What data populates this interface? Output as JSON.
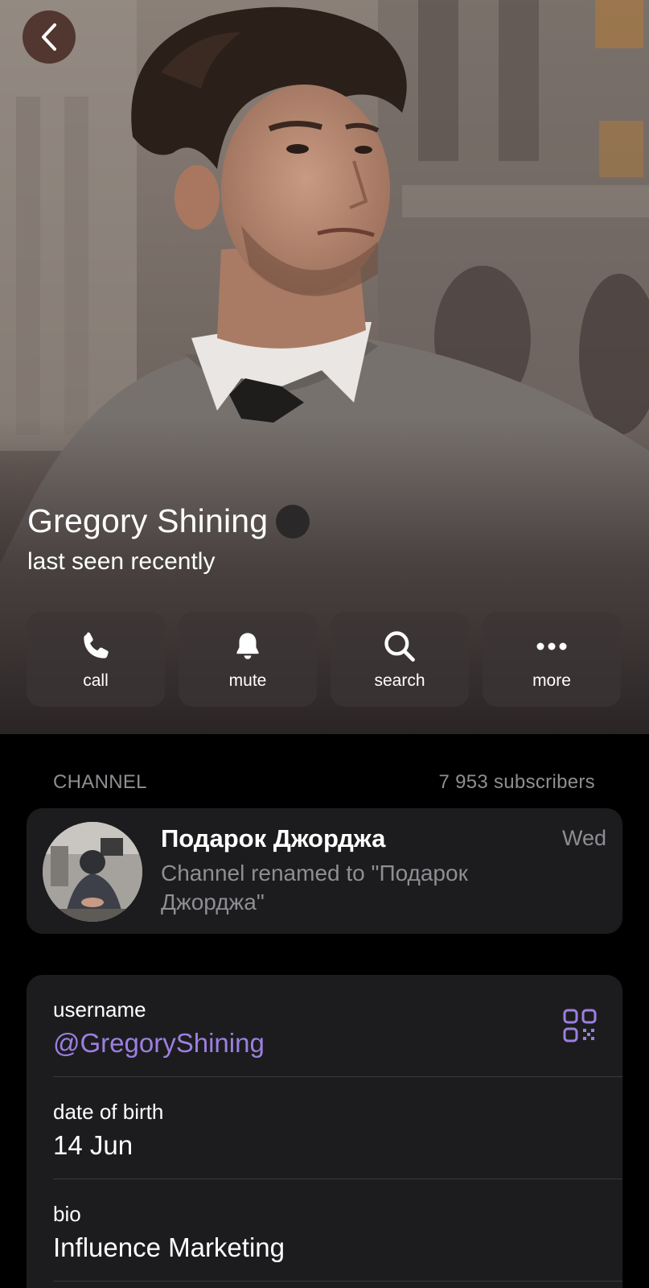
{
  "profile": {
    "name": "Gregory Shining",
    "status": "last seen recently"
  },
  "actions": [
    {
      "label": "call",
      "icon": "phone-icon"
    },
    {
      "label": "mute",
      "icon": "bell-icon"
    },
    {
      "label": "search",
      "icon": "search-icon"
    },
    {
      "label": "more",
      "icon": "more-dots-icon"
    }
  ],
  "channel_section": {
    "header": "CHANNEL",
    "subscribers": "7 953 subscribers",
    "channel": {
      "title": "Подарок Джорджа",
      "time": "Wed",
      "preview": "Channel renamed to \"Подарок Джорджа\""
    }
  },
  "info": {
    "username_label": "username",
    "username_value": "@GregoryShining",
    "birth_label": "date of birth",
    "birth_value": "14 Jun",
    "bio_label": "bio",
    "bio_value": "Influence Marketing"
  },
  "colors": {
    "accent": "#9c7fe0",
    "card_bg": "#1c1c1e",
    "secondary_text": "#8e8e93"
  }
}
